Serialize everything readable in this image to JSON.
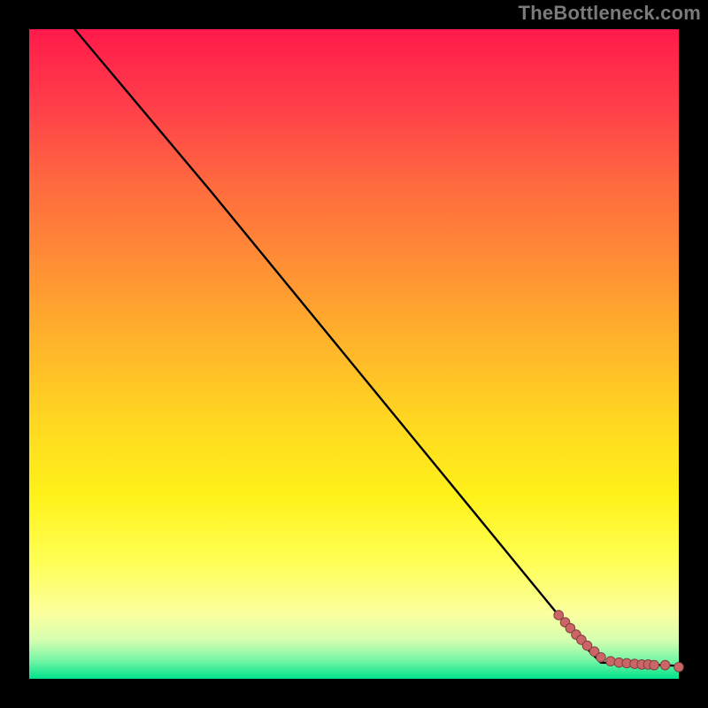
{
  "watermark": "TheBottleneck.com",
  "colors": {
    "background": "#000000",
    "curve": "#000000",
    "marker_fill": "#cc6666",
    "marker_stroke": "#814040",
    "gradient_top": "#ff1a4b",
    "gradient_bottom": "#00e28c"
  },
  "chart_data": {
    "type": "line",
    "title": "",
    "xlabel": "",
    "ylabel": "",
    "xlim": [
      0,
      100
    ],
    "ylim": [
      0,
      100
    ],
    "grid": false,
    "curve": {
      "x": [
        7,
        28,
        85,
        88,
        100
      ],
      "y": [
        100,
        75,
        5.5,
        2.5,
        2.0
      ]
    },
    "series": [
      {
        "name": "markers",
        "x": [
          81.5,
          82.5,
          83.3,
          84.2,
          85.0,
          85.9,
          87.0,
          88.0,
          89.5,
          90.8,
          92.0,
          93.2,
          94.3,
          95.3,
          96.2,
          97.9,
          100.0
        ],
        "y": [
          9.8,
          8.7,
          7.8,
          6.8,
          6.0,
          5.1,
          4.2,
          3.3,
          2.7,
          2.5,
          2.4,
          2.3,
          2.2,
          2.2,
          2.1,
          2.1,
          1.8
        ]
      }
    ]
  }
}
